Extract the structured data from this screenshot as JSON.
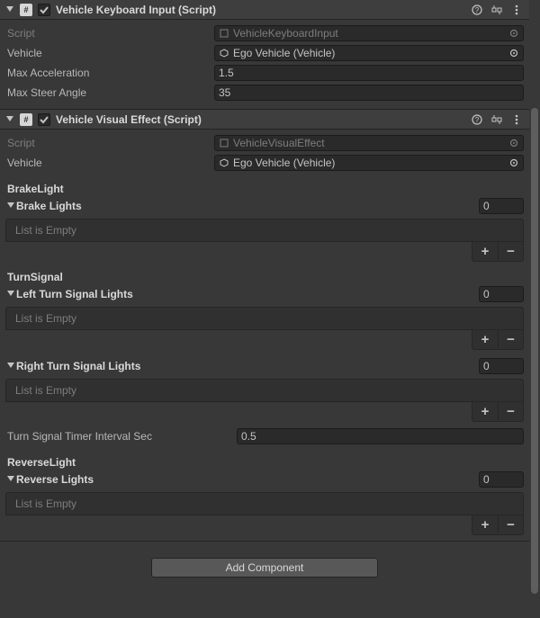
{
  "components": [
    {
      "id": "vki",
      "title": "Vehicle Keyboard Input (Script)",
      "enabled": true,
      "script_label": "Script",
      "script_value": "VehicleKeyboardInput",
      "vehicle_label": "Vehicle",
      "vehicle_value": "Ego Vehicle (Vehicle)",
      "max_accel_label": "Max Acceleration",
      "max_accel_value": "1.5",
      "max_steer_label": "Max Steer Angle",
      "max_steer_value": "35"
    },
    {
      "id": "vve",
      "title": "Vehicle Visual Effect (Script)",
      "enabled": true,
      "script_label": "Script",
      "script_value": "VehicleVisualEffect",
      "vehicle_label": "Vehicle",
      "vehicle_value": "Ego Vehicle (Vehicle)",
      "brake_heading": "BrakeLight",
      "brake_lights_label": "Brake Lights",
      "brake_lights_count": "0",
      "brake_lights_empty": "List is Empty",
      "turn_heading": "TurnSignal",
      "left_lights_label": "Left Turn Signal Lights",
      "left_lights_count": "0",
      "left_lights_empty": "List is Empty",
      "right_lights_label": "Right Turn Signal Lights",
      "right_lights_count": "0",
      "right_lights_empty": "List is Empty",
      "turn_timer_label": "Turn Signal Timer Interval Sec",
      "turn_timer_value": "0.5",
      "reverse_heading": "ReverseLight",
      "reverse_lights_label": "Reverse Lights",
      "reverse_lights_count": "0",
      "reverse_lights_empty": "List is Empty"
    }
  ],
  "add_component_label": "Add Component",
  "glyphs": {
    "plus": "+",
    "minus": "−",
    "hash": "#"
  }
}
